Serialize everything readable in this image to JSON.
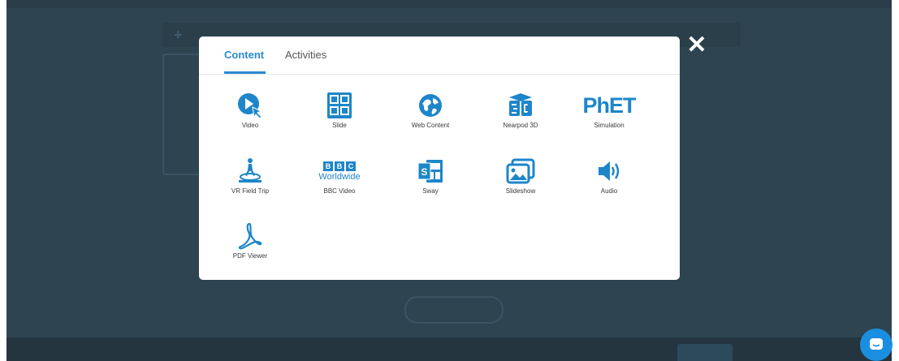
{
  "background": {
    "toolbar_plus": "+",
    "upload_button_label": ""
  },
  "modal": {
    "close_icon": "✕",
    "tabs": [
      {
        "label": "Content",
        "active": true
      },
      {
        "label": "Activities",
        "active": false
      }
    ],
    "items": [
      {
        "label": "Video",
        "icon": "video-play-icon"
      },
      {
        "label": "Slide",
        "icon": "slide-grid-icon"
      },
      {
        "label": "Web Content",
        "icon": "globe-icon"
      },
      {
        "label": "Nearpod 3D",
        "icon": "cube-3d-icon"
      },
      {
        "label": "Simulation",
        "icon": "phet-logo",
        "logo_text": "PhET"
      },
      {
        "label": "VR Field Trip",
        "icon": "vr-field-trip-icon"
      },
      {
        "label": "BBC Video",
        "icon": "bbc-worldwide-logo",
        "logo_text": "BBC",
        "logo_sub": "Worldwide"
      },
      {
        "label": "Sway",
        "icon": "sway-icon"
      },
      {
        "label": "Slideshow",
        "icon": "slideshow-images-icon"
      },
      {
        "label": "Audio",
        "icon": "speaker-icon"
      },
      {
        "label": "PDF Viewer",
        "icon": "pdf-icon"
      }
    ]
  },
  "chat_widget": {
    "icon": "chat-bubble-icon"
  },
  "colors": {
    "accent": "#2a8bd0",
    "icon_blue": "#1d86c9",
    "overlay": "#2f4451",
    "chat": "#1a8fe0"
  }
}
